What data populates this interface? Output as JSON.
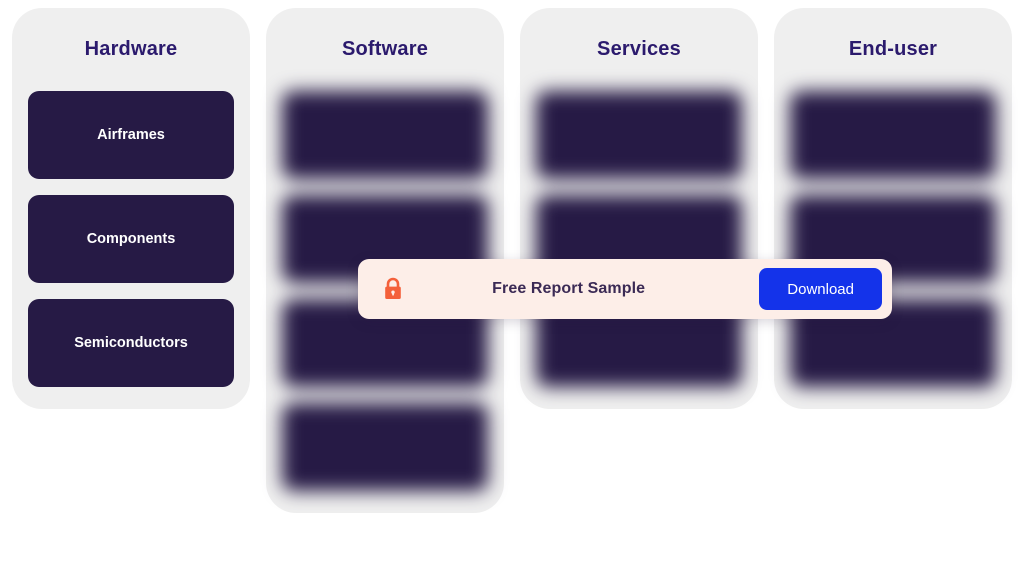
{
  "colors": {
    "page_background": "#ffffff",
    "column_background": "#efefef",
    "card_background": "#261a45",
    "card_text": "#ffffff",
    "column_title_text": "#2b1a6d",
    "banner_background": "#fdeee8",
    "banner_text": "#3b2a55",
    "download_button_background": "#1433ea",
    "download_button_text": "#ffffff",
    "lock_icon": "#f4603a"
  },
  "columns": [
    {
      "title": "Hardware",
      "locked": false,
      "cards": [
        {
          "label": "Airframes"
        },
        {
          "label": "Components"
        },
        {
          "label": "Semiconductors"
        }
      ]
    },
    {
      "title": "Software",
      "locked": true,
      "cards": [
        {
          "label": ""
        },
        {
          "label": ""
        },
        {
          "label": ""
        },
        {
          "label": ""
        }
      ]
    },
    {
      "title": "Services",
      "locked": true,
      "cards": [
        {
          "label": ""
        },
        {
          "label": ""
        },
        {
          "label": ""
        }
      ]
    },
    {
      "title": "End-user",
      "locked": true,
      "cards": [
        {
          "label": ""
        },
        {
          "label": ""
        },
        {
          "label": ""
        }
      ]
    }
  ],
  "lock_banner": {
    "icon": "padlock-closed-icon",
    "label": "Free Report Sample",
    "download_label": "Download"
  }
}
